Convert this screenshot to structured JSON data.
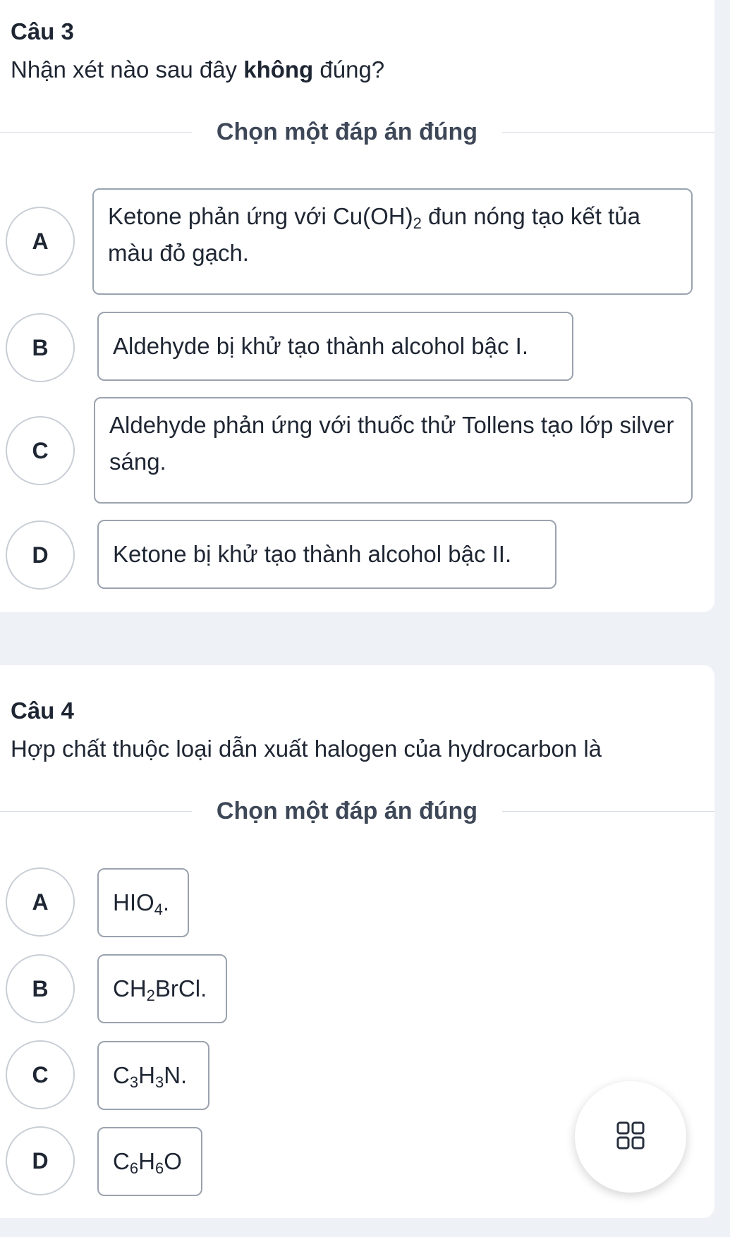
{
  "questions": [
    {
      "title": "Câu 3",
      "prompt_before": "Nhận xét nào sau đây ",
      "prompt_bold": "không",
      "prompt_after": " đúng?",
      "instruction": "Chọn một đáp án đúng",
      "options": [
        {
          "letter": "A",
          "parts": [
            {
              "t": "Ketone phản ứng với Cu(OH)"
            },
            {
              "sub": "2"
            },
            {
              "t": " đun nóng tạo kết tủa màu đỏ gạch."
            }
          ]
        },
        {
          "letter": "B",
          "parts": [
            {
              "t": "Aldehyde bị khử tạo thành alcohol bậc I."
            }
          ]
        },
        {
          "letter": "C",
          "parts": [
            {
              "t": "Aldehyde phản ứng với thuốc thử Tollens tạo lớp silver sáng."
            }
          ]
        },
        {
          "letter": "D",
          "parts": [
            {
              "t": "Ketone bị khử tạo thành alcohol bậc II."
            }
          ]
        }
      ]
    },
    {
      "title": "Câu 4",
      "prompt_before": "Hợp chất thuộc loại dẫn xuất halogen của hydrocarbon là",
      "prompt_bold": "",
      "prompt_after": "",
      "instruction": "Chọn một đáp án đúng",
      "options": [
        {
          "letter": "A",
          "parts": [
            {
              "t": "HIO"
            },
            {
              "sub": "4"
            },
            {
              "t": "."
            }
          ]
        },
        {
          "letter": "B",
          "parts": [
            {
              "t": "CH"
            },
            {
              "sub": "2"
            },
            {
              "t": "BrCl."
            }
          ]
        },
        {
          "letter": "C",
          "parts": [
            {
              "t": "C"
            },
            {
              "sub": "3"
            },
            {
              "t": "H"
            },
            {
              "sub": "3"
            },
            {
              "t": "N."
            }
          ]
        },
        {
          "letter": "D",
          "parts": [
            {
              "t": "C"
            },
            {
              "sub": "6"
            },
            {
              "t": "H"
            },
            {
              "sub": "6"
            },
            {
              "t": "O"
            }
          ]
        }
      ]
    }
  ],
  "fab": {
    "icon": "grid-icon"
  },
  "colors": {
    "page_bg": "#eef1f5",
    "card_bg": "#ffffff",
    "text": "#1f2633",
    "border": "#9aa3ae"
  }
}
